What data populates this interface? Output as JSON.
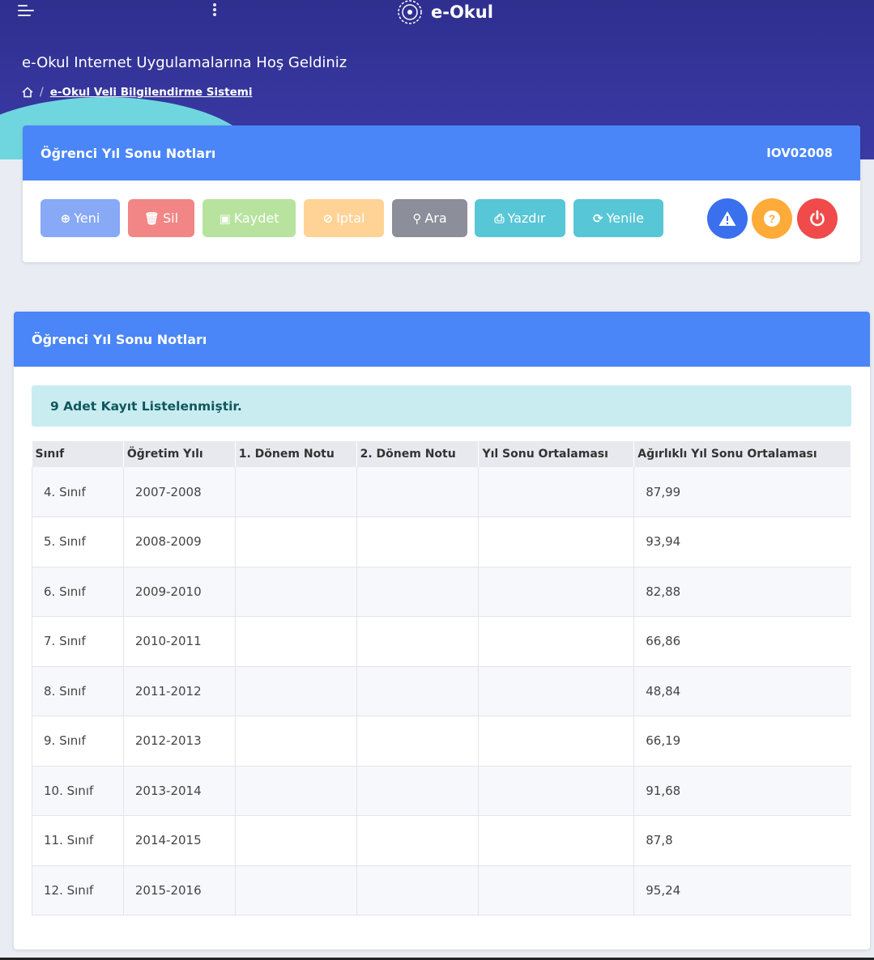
{
  "header": {
    "brand": "e-Okul",
    "welcome": "e-Okul Internet Uygulamalarına Hoş Geldiniz",
    "breadcrumb": "e-Okul Veli Bilgilendirme Sistemi"
  },
  "top_card": {
    "title": "Öğrenci Yıl Sonu Notları",
    "code": "IOV02008",
    "buttons": {
      "yeni": "Yeni",
      "sil": "Sil",
      "kaydet": "Kaydet",
      "iptal": "Iptal",
      "ara": "Ara",
      "yazdir": "Yazdır",
      "yenile": "Yenile"
    },
    "colors": {
      "yeni": "#87a9f6",
      "sil": "#f28585",
      "kaydet": "#b7e39e",
      "iptal": "#ffd295",
      "ara": "#8c8f99",
      "yazdir": "#57c6d6",
      "yenile": "#57c6d6",
      "warning": "#3a70ee",
      "help": "#ffab3a",
      "power": "#f04a4a"
    }
  },
  "list_card": {
    "title": "Öğrenci Yıl Sonu Notları",
    "alert": "9 Adet Kayıt Listelenmiştir.",
    "columns": [
      "Sınıf",
      "Öğretim Yılı",
      "1. Dönem Notu",
      "2. Dönem Notu",
      "Yıl Sonu Ortalaması",
      "Ağırlıklı Yıl Sonu Ortalaması"
    ],
    "rows": [
      [
        "4. Sınıf",
        "2007-2008",
        "",
        "",
        "",
        "87,99"
      ],
      [
        "5. Sınıf",
        "2008-2009",
        "",
        "",
        "",
        "93,94"
      ],
      [
        "6. Sınıf",
        "2009-2010",
        "",
        "",
        "",
        "82,88"
      ],
      [
        "7. Sınıf",
        "2010-2011",
        "",
        "",
        "",
        "66,86"
      ],
      [
        "8. Sınıf",
        "2011-2012",
        "",
        "",
        "",
        "48,84"
      ],
      [
        "9. Sınıf",
        "2012-2013",
        "",
        "",
        "",
        "66,19"
      ],
      [
        "10. Sınıf",
        "2013-2014",
        "",
        "",
        "",
        "91,68"
      ],
      [
        "11. Sınıf",
        "2014-2015",
        "",
        "",
        "",
        "87,8"
      ],
      [
        "12. Sınıf",
        "2015-2016",
        "",
        "",
        "",
        "95,24"
      ]
    ]
  }
}
